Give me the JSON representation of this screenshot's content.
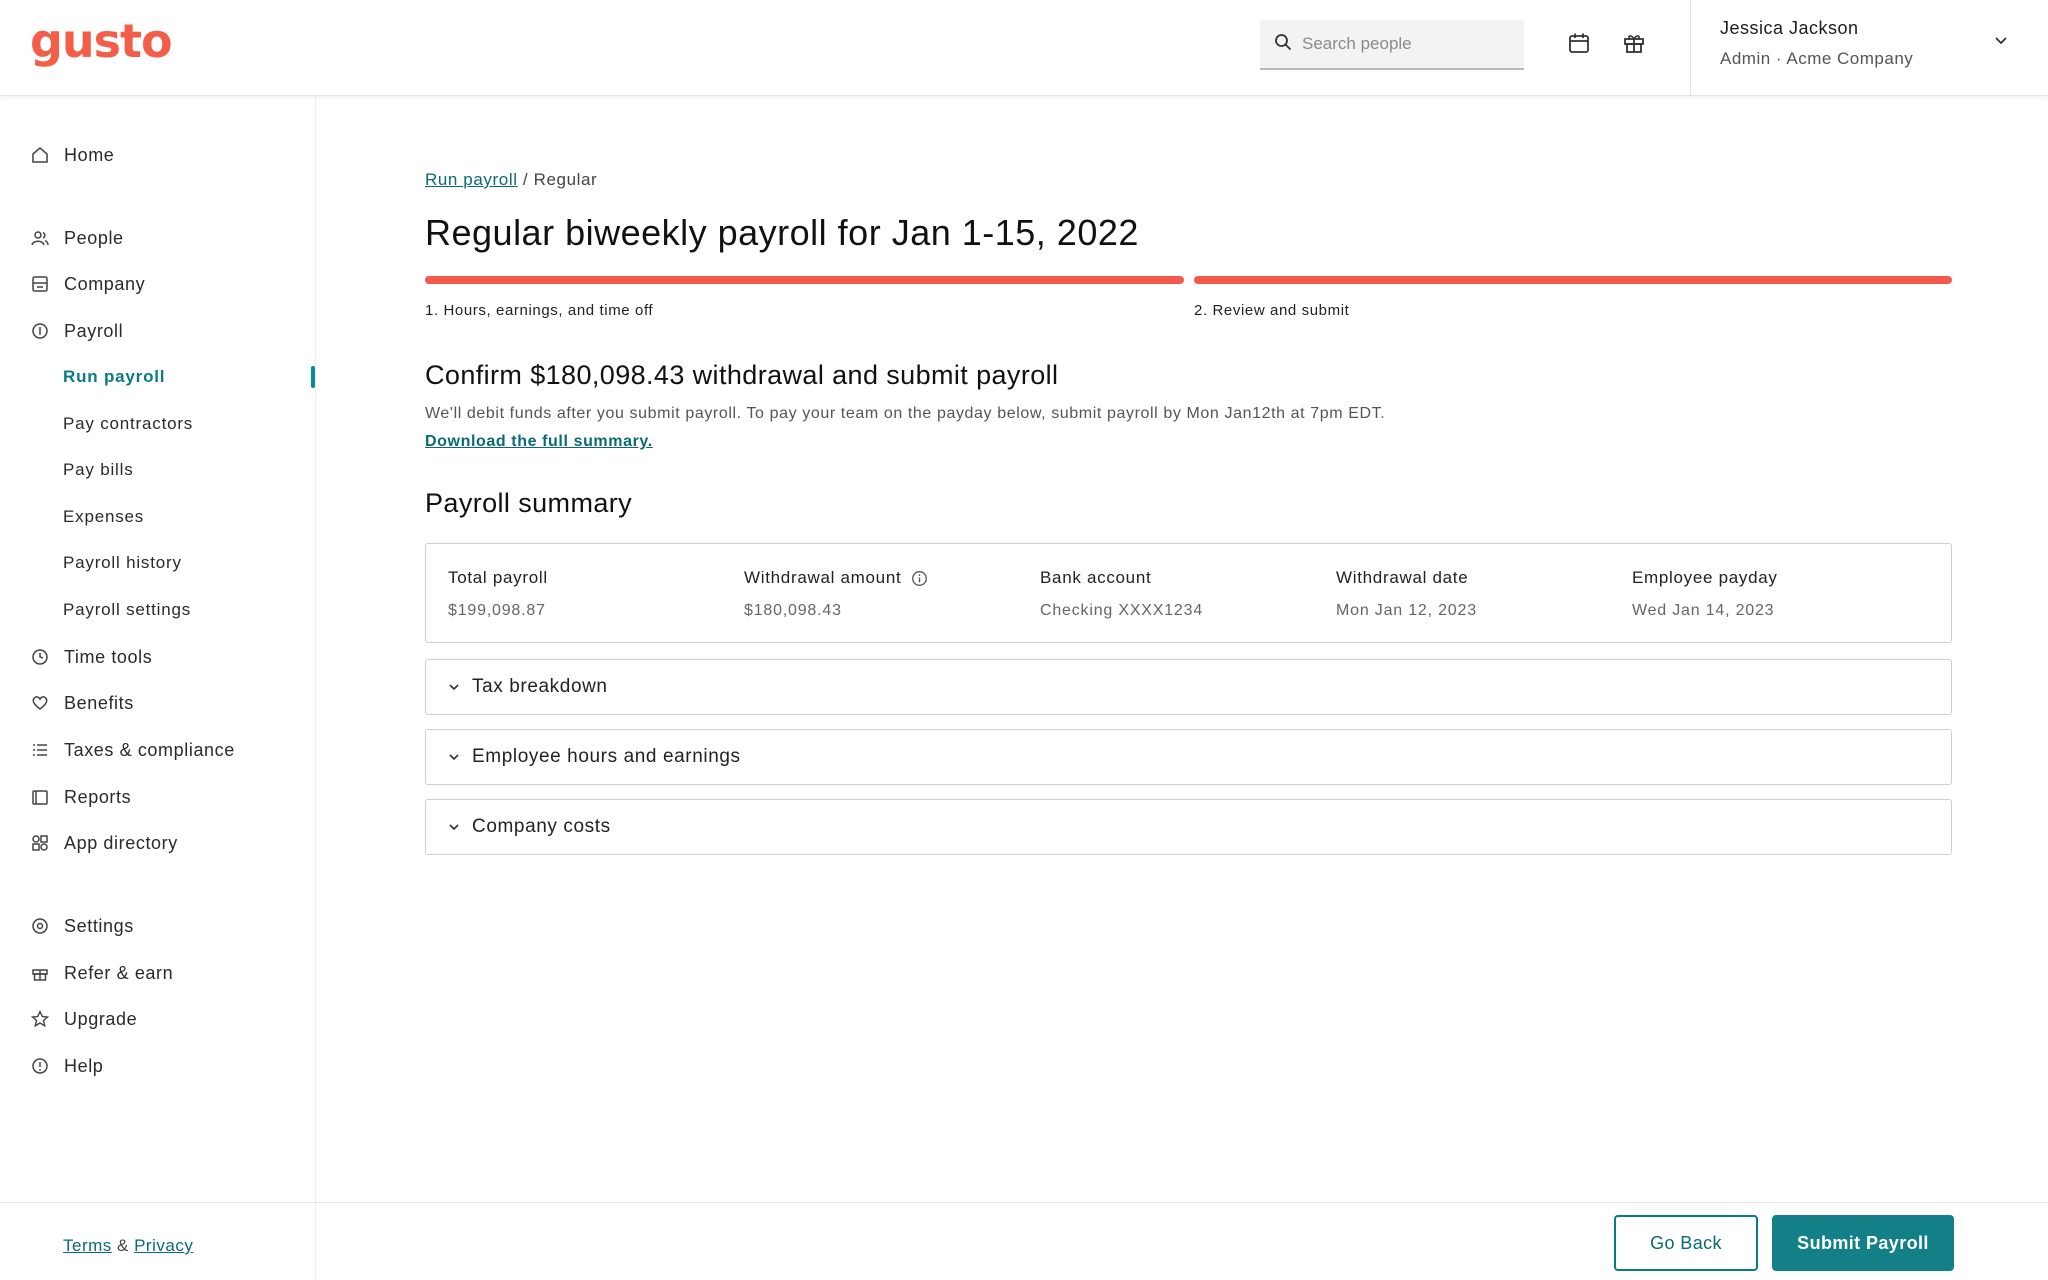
{
  "header": {
    "logo": "gusto",
    "search_placeholder": "Search people",
    "user_name": "Jessica Jackson",
    "user_role": "Admin · Acme Company"
  },
  "sidebar": {
    "items": [
      {
        "label": "Home",
        "icon": "home-icon"
      },
      {
        "label": "People",
        "icon": "people-icon"
      },
      {
        "label": "Company",
        "icon": "company-icon"
      },
      {
        "label": "Payroll",
        "icon": "payroll-icon"
      },
      {
        "label": "Time tools",
        "icon": "clock-icon"
      },
      {
        "label": "Benefits",
        "icon": "heart-icon"
      },
      {
        "label": "Taxes & compliance",
        "icon": "list-icon"
      },
      {
        "label": "Reports",
        "icon": "reports-icon"
      },
      {
        "label": "App directory",
        "icon": "apps-icon"
      },
      {
        "label": "Settings",
        "icon": "gear-icon"
      },
      {
        "label": "Refer & earn",
        "icon": "gift-icon"
      },
      {
        "label": "Upgrade",
        "icon": "star-icon"
      },
      {
        "label": "Help",
        "icon": "help-icon"
      }
    ],
    "payroll_sub": [
      "Run payroll",
      "Pay contractors",
      "Pay bills",
      "Expenses",
      "Payroll history",
      "Payroll settings"
    ],
    "footer": {
      "terms": "Terms",
      "amp": "&",
      "privacy": "Privacy"
    }
  },
  "main": {
    "breadcrumb_link": "Run payroll",
    "breadcrumb_sep": "/",
    "breadcrumb_current": "Regular",
    "title": "Regular biweekly payroll for Jan 1-15, 2022",
    "steps": [
      "1. Hours, earnings, and time off",
      "2. Review and submit"
    ],
    "confirm_title": "Confirm $180,098.43 withdrawal and submit payroll",
    "confirm_desc": "We'll debit funds after you submit payroll. To pay your team on the payday below, submit payroll by Mon Jan12th at 7pm EDT.",
    "confirm_link": "Download the full summary.",
    "summary_title": "Payroll summary",
    "summary": [
      {
        "label": "Total payroll",
        "value": "$199,098.87"
      },
      {
        "label": "Withdrawal amount",
        "value": "$180,098.43"
      },
      {
        "label": "Bank account",
        "value": "Checking XXXX1234"
      },
      {
        "label": "Withdrawal date",
        "value": "Mon Jan 12, 2023"
      },
      {
        "label": "Employee payday",
        "value": "Wed Jan 14, 2023"
      }
    ],
    "accordions": [
      "Tax breakdown",
      "Employee hours and earnings",
      "Company costs"
    ]
  },
  "actions": {
    "back": "Go Back",
    "submit": "Submit Payroll"
  },
  "colors": {
    "brand": "#f45d48",
    "accent": "#137f86",
    "progress": "#f4584a"
  }
}
